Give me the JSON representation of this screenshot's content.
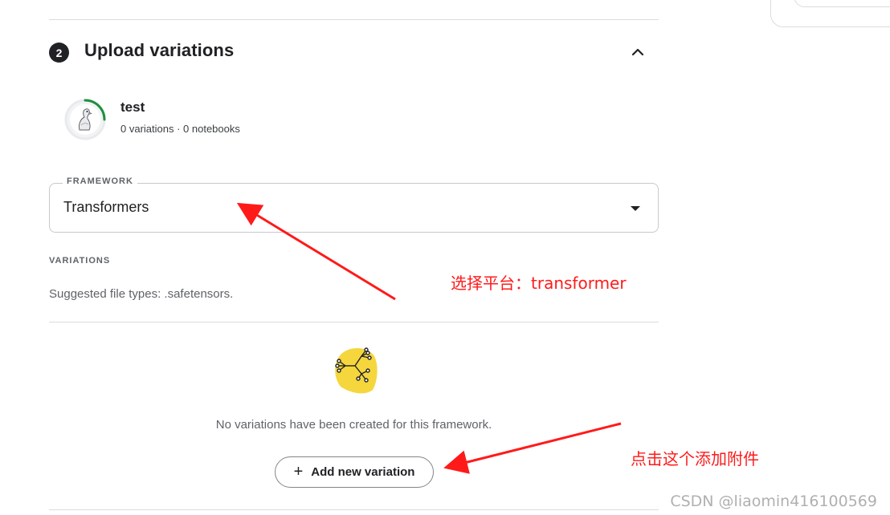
{
  "section": {
    "step_number": "2",
    "title": "Upload variations"
  },
  "model": {
    "name": "test",
    "meta": "0 variations · 0 notebooks",
    "progress_fraction": 0.25
  },
  "framework": {
    "label": "FRAMEWORK",
    "value": "Transformers"
  },
  "variations": {
    "label": "VARIATIONS",
    "suggested": "Suggested file types: .safetensors.",
    "empty_text": "No variations have been created for this framework.",
    "add_button": "Add new variation",
    "add_icon": "+"
  },
  "annotations": {
    "note_framework": "选择平台：transformer",
    "note_add": "点击这个添加附件",
    "color": "#ff1a1a"
  },
  "watermark": "CSDN @liaomin416100569",
  "colors": {
    "accent_green": "#1e8e3e",
    "illustration_yellow": "#f5d63d"
  }
}
